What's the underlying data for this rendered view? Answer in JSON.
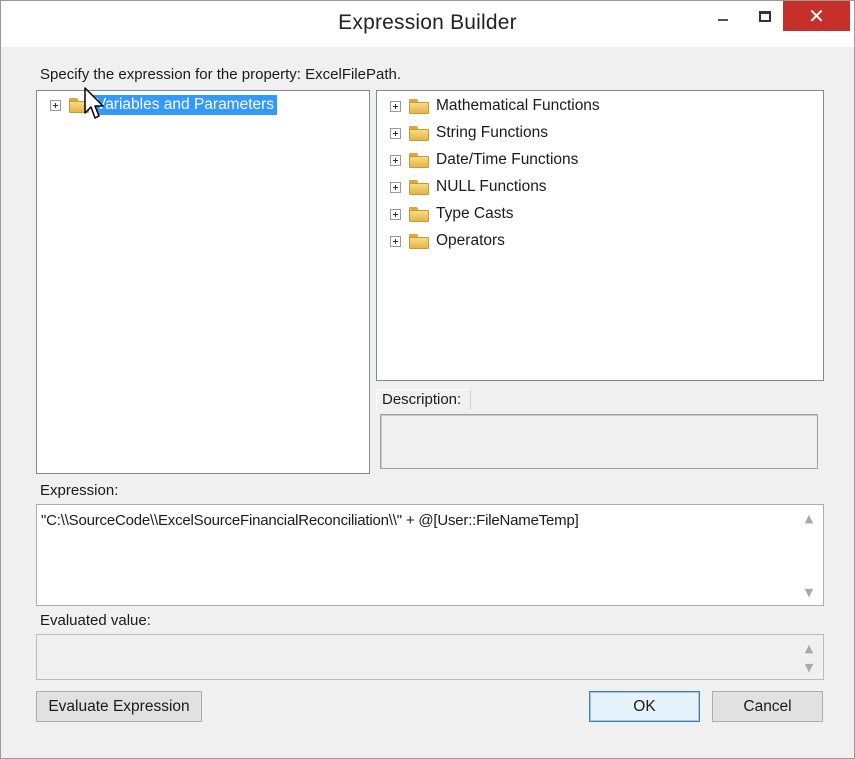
{
  "window": {
    "title": "Expression Builder",
    "close_glyph": "✕",
    "accent_close": "#c7302a"
  },
  "prompt": "Specify the expression for the property: ExcelFilePath.",
  "left_tree": {
    "items": [
      {
        "label": "Variables and Parameters",
        "selected": true,
        "icon": "folder-icon"
      }
    ]
  },
  "right_tree": {
    "items": [
      {
        "label": "Mathematical Functions",
        "icon": "folder-icon"
      },
      {
        "label": "String Functions",
        "icon": "folder-icon"
      },
      {
        "label": "Date/Time Functions",
        "icon": "folder-icon"
      },
      {
        "label": "NULL Functions",
        "icon": "folder-icon"
      },
      {
        "label": "Type Casts",
        "icon": "folder-icon"
      },
      {
        "label": "Operators",
        "icon": "folder-icon"
      }
    ]
  },
  "description": {
    "label": "Description:",
    "value": ""
  },
  "expression": {
    "label": "Expression:",
    "value": "\"C:\\\\SourceCode\\\\ExcelSourceFinancialReconciliation\\\\\" + @[User::FileNameTemp]"
  },
  "evaluated": {
    "label": "Evaluated value:",
    "value": ""
  },
  "buttons": {
    "evaluate": "Evaluate Expression",
    "ok": "OK",
    "cancel": "Cancel"
  },
  "scroll": {
    "up": "▲",
    "down": "▼"
  },
  "selection_color": "#3399ff"
}
